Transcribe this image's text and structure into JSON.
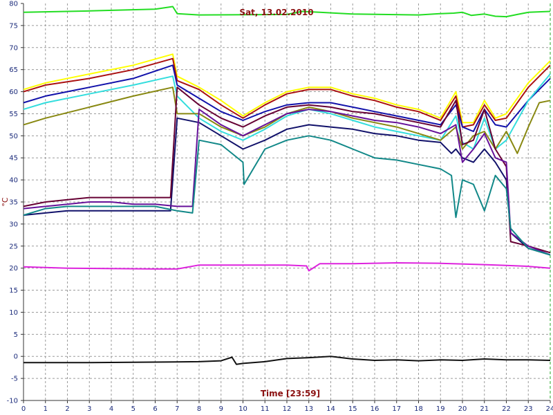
{
  "chart_data": {
    "type": "line",
    "title": "Sat, 13.02.2010",
    "xlabel": "Time [23:59]",
    "ylabel": "°C",
    "xlim": [
      0,
      24
    ],
    "ylim": [
      -10,
      80
    ],
    "xticks": [
      0,
      1,
      2,
      3,
      4,
      5,
      6,
      7,
      8,
      9,
      10,
      11,
      12,
      13,
      14,
      15,
      16,
      17,
      18,
      19,
      20,
      21,
      22,
      23,
      24
    ],
    "yticks": [
      -10,
      -5,
      0,
      5,
      10,
      15,
      20,
      25,
      30,
      35,
      40,
      45,
      50,
      55,
      60,
      65,
      70,
      75,
      80
    ],
    "grid": true,
    "series": [
      {
        "color": "#22dd22",
        "points": [
          [
            0,
            78
          ],
          [
            3,
            78.3
          ],
          [
            6,
            78.7
          ],
          [
            6.8,
            79.3
          ],
          [
            7,
            77.7
          ],
          [
            8,
            77.4
          ],
          [
            12,
            77.5
          ],
          [
            12.7,
            78.2
          ],
          [
            13.5,
            78
          ],
          [
            15,
            77.6
          ],
          [
            18,
            77.4
          ],
          [
            19,
            77.7
          ],
          [
            19.6,
            77.8
          ],
          [
            20,
            78
          ],
          [
            20.4,
            77.3
          ],
          [
            21,
            77.6
          ],
          [
            21.5,
            77.1
          ],
          [
            22,
            77
          ],
          [
            22.5,
            77.5
          ],
          [
            23,
            78
          ],
          [
            24,
            78.2
          ]
        ]
      },
      {
        "color": "#dd22dd",
        "points": [
          [
            0,
            20.3
          ],
          [
            2,
            20
          ],
          [
            6,
            19.8
          ],
          [
            7,
            19.8
          ],
          [
            8,
            20.7
          ],
          [
            10,
            20.7
          ],
          [
            12,
            20.7
          ],
          [
            12.9,
            20.5
          ],
          [
            13,
            19.4
          ],
          [
            13.5,
            21
          ],
          [
            15,
            21
          ],
          [
            17,
            21.2
          ],
          [
            19,
            21.1
          ],
          [
            21,
            20.8
          ],
          [
            22,
            20.6
          ],
          [
            23,
            20.4
          ],
          [
            24,
            20
          ]
        ]
      },
      {
        "color": "#111111",
        "points": [
          [
            0,
            -1.4
          ],
          [
            3,
            -1.4
          ],
          [
            6,
            -1.3
          ],
          [
            8,
            -1.2
          ],
          [
            9,
            -1.0
          ],
          [
            9.5,
            -0.2
          ],
          [
            9.7,
            -1.8
          ],
          [
            10,
            -1.6
          ],
          [
            11,
            -1.2
          ],
          [
            12,
            -0.5
          ],
          [
            13,
            -0.3
          ],
          [
            14,
            0
          ],
          [
            15,
            -0.6
          ],
          [
            16,
            -0.9
          ],
          [
            17,
            -0.8
          ],
          [
            18,
            -1.0
          ],
          [
            19,
            -0.8
          ],
          [
            20,
            -0.9
          ],
          [
            21,
            -0.6
          ],
          [
            22,
            -0.8
          ],
          [
            23,
            -0.8
          ],
          [
            24,
            -0.9
          ]
        ]
      },
      {
        "color": "#ffff00",
        "points": [
          [
            0,
            60.5
          ],
          [
            1,
            62
          ],
          [
            3,
            64
          ],
          [
            5,
            66
          ],
          [
            6.8,
            68.5
          ],
          [
            7,
            63.5
          ],
          [
            8,
            61
          ],
          [
            9,
            58
          ],
          [
            10,
            54.5
          ],
          [
            11,
            57.5
          ],
          [
            12,
            60
          ],
          [
            13,
            61
          ],
          [
            14,
            61
          ],
          [
            15,
            59.5
          ],
          [
            16,
            58.5
          ],
          [
            17,
            57
          ],
          [
            18,
            56
          ],
          [
            19,
            54
          ],
          [
            19.7,
            60
          ],
          [
            20,
            53
          ],
          [
            20.5,
            53
          ],
          [
            21,
            58
          ],
          [
            21.5,
            54
          ],
          [
            22,
            55
          ],
          [
            23,
            62
          ],
          [
            24,
            67
          ]
        ]
      },
      {
        "color": "#aa1111",
        "points": [
          [
            0,
            60
          ],
          [
            1,
            61.5
          ],
          [
            3,
            63
          ],
          [
            5,
            65
          ],
          [
            6.8,
            67.5
          ],
          [
            7,
            62.5
          ],
          [
            8,
            60.5
          ],
          [
            9,
            57
          ],
          [
            10,
            54
          ],
          [
            11,
            57
          ],
          [
            12,
            59.5
          ],
          [
            13,
            60.5
          ],
          [
            14,
            60.5
          ],
          [
            15,
            59
          ],
          [
            16,
            58
          ],
          [
            17,
            56.5
          ],
          [
            18,
            55.5
          ],
          [
            19,
            53.5
          ],
          [
            19.7,
            59
          ],
          [
            20,
            52
          ],
          [
            20.5,
            52.5
          ],
          [
            21,
            57
          ],
          [
            21.5,
            53.5
          ],
          [
            22,
            54
          ],
          [
            23,
            61
          ],
          [
            24,
            66
          ]
        ]
      },
      {
        "color": "#1111aa",
        "points": [
          [
            0,
            57.5
          ],
          [
            1,
            59
          ],
          [
            3,
            61
          ],
          [
            5,
            63
          ],
          [
            6.8,
            66
          ],
          [
            7,
            61.5
          ],
          [
            8,
            58.5
          ],
          [
            9,
            55.5
          ],
          [
            10,
            53.5
          ],
          [
            11,
            55.5
          ],
          [
            12,
            57
          ],
          [
            13,
            57.5
          ],
          [
            14,
            57.5
          ],
          [
            15,
            56.5
          ],
          [
            16,
            55.5
          ],
          [
            17,
            54.5
          ],
          [
            18,
            53.5
          ],
          [
            19,
            52.5
          ],
          [
            19.7,
            57
          ],
          [
            20,
            52
          ],
          [
            20.5,
            51
          ],
          [
            21,
            56
          ],
          [
            21.5,
            52.5
          ],
          [
            22,
            52
          ],
          [
            23,
            58
          ],
          [
            24,
            63
          ]
        ]
      },
      {
        "color": "#33dddd",
        "points": [
          [
            0,
            56
          ],
          [
            1,
            57.5
          ],
          [
            3,
            59.5
          ],
          [
            5,
            61.5
          ],
          [
            6.8,
            63.5
          ],
          [
            7,
            59
          ],
          [
            8,
            54
          ],
          [
            9,
            51
          ],
          [
            10,
            49
          ],
          [
            11,
            51.5
          ],
          [
            12,
            54.5
          ],
          [
            13,
            56
          ],
          [
            14,
            55
          ],
          [
            15,
            53.5
          ],
          [
            16,
            52
          ],
          [
            17,
            51
          ],
          [
            18,
            50
          ],
          [
            19,
            49
          ],
          [
            19.7,
            54.5
          ],
          [
            20,
            48.5
          ],
          [
            20.5,
            47
          ],
          [
            21,
            54
          ],
          [
            21.5,
            47
          ],
          [
            22,
            49
          ],
          [
            23,
            58
          ],
          [
            24,
            64
          ]
        ]
      },
      {
        "color": "#888811",
        "points": [
          [
            0,
            52.5
          ],
          [
            1,
            54
          ],
          [
            3,
            56.5
          ],
          [
            5,
            59
          ],
          [
            6.8,
            61
          ],
          [
            7,
            55
          ],
          [
            8,
            55
          ],
          [
            9,
            52
          ],
          [
            10,
            50
          ],
          [
            11,
            52
          ],
          [
            12,
            55
          ],
          [
            13,
            56.5
          ],
          [
            14,
            55.5
          ],
          [
            15,
            54
          ],
          [
            16,
            53
          ],
          [
            17,
            52
          ],
          [
            18,
            50.5
          ],
          [
            19,
            49
          ],
          [
            19.7,
            52
          ],
          [
            20,
            47
          ],
          [
            20.5,
            50
          ],
          [
            21,
            51
          ],
          [
            21.5,
            47
          ],
          [
            22,
            51
          ],
          [
            22.5,
            46
          ],
          [
            23,
            52
          ],
          [
            23.5,
            57.5
          ],
          [
            24,
            58
          ]
        ]
      },
      {
        "color": "#11116a",
        "points": [
          [
            0,
            32
          ],
          [
            1,
            32.5
          ],
          [
            2,
            33
          ],
          [
            3,
            33
          ],
          [
            4,
            33
          ],
          [
            5,
            33
          ],
          [
            6,
            33
          ],
          [
            6.7,
            33
          ],
          [
            7,
            54
          ],
          [
            8,
            53
          ],
          [
            9,
            50
          ],
          [
            10,
            47
          ],
          [
            11,
            49
          ],
          [
            12,
            51.5
          ],
          [
            13,
            52.5
          ],
          [
            14,
            52
          ],
          [
            15,
            51.5
          ],
          [
            16,
            50.5
          ],
          [
            17,
            50
          ],
          [
            18,
            49
          ],
          [
            19,
            48.5
          ],
          [
            19.5,
            46
          ],
          [
            19.7,
            47
          ],
          [
            20,
            45
          ],
          [
            20.5,
            44
          ],
          [
            21,
            47
          ],
          [
            21.5,
            44
          ],
          [
            22,
            40
          ],
          [
            22.2,
            28
          ],
          [
            23,
            24.5
          ],
          [
            24,
            23
          ]
        ]
      },
      {
        "color": "#660033",
        "points": [
          [
            0,
            34
          ],
          [
            1,
            35
          ],
          [
            2,
            35.5
          ],
          [
            3,
            36
          ],
          [
            4,
            36
          ],
          [
            5,
            36
          ],
          [
            6,
            36
          ],
          [
            6.7,
            36
          ],
          [
            7,
            61
          ],
          [
            8,
            57
          ],
          [
            9,
            54
          ],
          [
            10,
            52
          ],
          [
            11,
            54.5
          ],
          [
            12,
            56.5
          ],
          [
            13,
            57
          ],
          [
            14,
            56.5
          ],
          [
            15,
            55.5
          ],
          [
            16,
            55
          ],
          [
            17,
            54
          ],
          [
            18,
            53
          ],
          [
            19,
            52
          ],
          [
            19.7,
            58
          ],
          [
            20,
            48
          ],
          [
            20.5,
            49
          ],
          [
            21,
            56
          ],
          [
            21.5,
            47
          ],
          [
            22,
            43
          ],
          [
            22.2,
            26
          ],
          [
            23,
            25
          ],
          [
            24,
            23.5
          ]
        ]
      },
      {
        "color": "#661199",
        "points": [
          [
            0,
            33.5
          ],
          [
            1,
            34
          ],
          [
            2,
            34.5
          ],
          [
            3,
            35
          ],
          [
            4,
            35
          ],
          [
            5,
            34.5
          ],
          [
            6,
            34.5
          ],
          [
            7,
            34
          ],
          [
            7.7,
            34
          ],
          [
            8,
            56
          ],
          [
            9,
            52.5
          ],
          [
            10,
            50
          ],
          [
            11,
            52.5
          ],
          [
            12,
            55
          ],
          [
            13,
            56
          ],
          [
            14,
            55.5
          ],
          [
            15,
            54.5
          ],
          [
            16,
            53.5
          ],
          [
            17,
            53
          ],
          [
            18,
            52
          ],
          [
            19,
            50.5
          ],
          [
            19.7,
            52.5
          ],
          [
            20,
            44
          ],
          [
            20.5,
            47
          ],
          [
            21,
            50.5
          ],
          [
            21.5,
            45
          ],
          [
            22,
            44
          ],
          [
            22.2,
            28
          ],
          [
            23,
            25
          ],
          [
            24,
            23
          ]
        ]
      },
      {
        "color": "#118888",
        "points": [
          [
            0,
            32
          ],
          [
            1,
            33.5
          ],
          [
            2,
            34
          ],
          [
            3,
            34
          ],
          [
            4,
            34
          ],
          [
            5,
            34
          ],
          [
            6,
            34
          ],
          [
            7,
            33
          ],
          [
            7.7,
            32.5
          ],
          [
            8,
            49
          ],
          [
            9,
            48
          ],
          [
            10,
            44
          ],
          [
            10.05,
            39
          ],
          [
            11,
            47
          ],
          [
            12,
            49
          ],
          [
            13,
            50
          ],
          [
            14,
            49
          ],
          [
            15,
            47
          ],
          [
            16,
            45
          ],
          [
            17,
            44.5
          ],
          [
            18,
            43.5
          ],
          [
            19,
            42.5
          ],
          [
            19.5,
            41
          ],
          [
            19.7,
            31.5
          ],
          [
            20,
            40
          ],
          [
            20.5,
            39
          ],
          [
            21,
            33
          ],
          [
            21.5,
            41
          ],
          [
            22,
            38
          ],
          [
            22.2,
            29
          ],
          [
            23,
            24.5
          ],
          [
            24,
            23
          ]
        ]
      }
    ]
  }
}
